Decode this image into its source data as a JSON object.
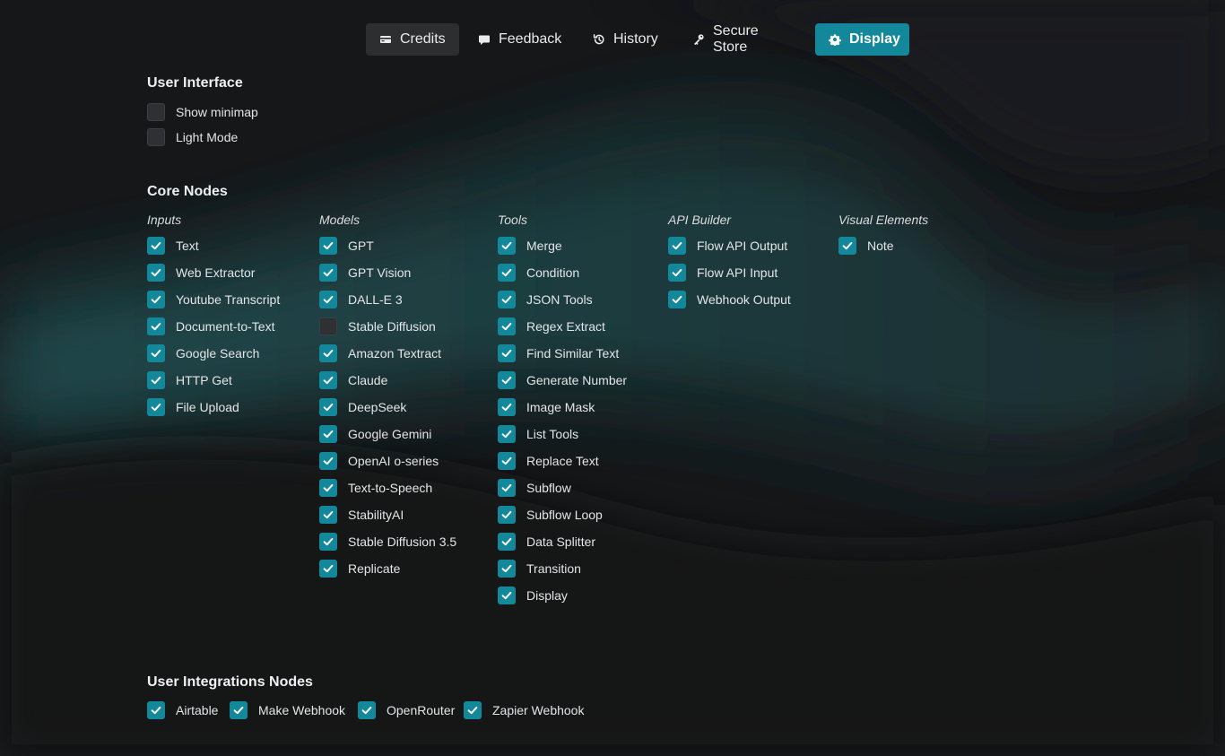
{
  "nav": {
    "tabs": [
      {
        "label": "Credits",
        "icon": "credit-card-icon"
      },
      {
        "label": "Feedback",
        "icon": "chat-bubble-icon"
      },
      {
        "label": "History",
        "icon": "history-icon"
      },
      {
        "label": "Secure Store",
        "icon": "key-icon"
      },
      {
        "label": "Display",
        "icon": "gear-icon"
      }
    ],
    "selected": "Display"
  },
  "colors": {
    "accent": "#12889a",
    "background": "#151719",
    "glow": "#1f4a4c"
  },
  "user_interface": {
    "title": "User Interface",
    "options": [
      {
        "label": "Show minimap",
        "checked": false
      },
      {
        "label": "Light Mode",
        "checked": false
      }
    ]
  },
  "core_nodes": {
    "title": "Core Nodes",
    "columns": [
      {
        "title": "Inputs",
        "items": [
          {
            "label": "Text",
            "checked": true
          },
          {
            "label": "Web Extractor",
            "checked": true
          },
          {
            "label": "Youtube Transcript",
            "checked": true
          },
          {
            "label": "Document-to-Text",
            "checked": true
          },
          {
            "label": "Google Search",
            "checked": true
          },
          {
            "label": "HTTP Get",
            "checked": true
          },
          {
            "label": "File Upload",
            "checked": true
          }
        ]
      },
      {
        "title": "Models",
        "items": [
          {
            "label": "GPT",
            "checked": true
          },
          {
            "label": "GPT Vision",
            "checked": true
          },
          {
            "label": "DALL-E 3",
            "checked": true
          },
          {
            "label": "Stable Diffusion",
            "checked": false
          },
          {
            "label": "Amazon Textract",
            "checked": true
          },
          {
            "label": "Claude",
            "checked": true
          },
          {
            "label": "DeepSeek",
            "checked": true
          },
          {
            "label": "Google Gemini",
            "checked": true
          },
          {
            "label": "OpenAI o-series",
            "checked": true
          },
          {
            "label": "Text-to-Speech",
            "checked": true
          },
          {
            "label": "StabilityAI",
            "checked": true
          },
          {
            "label": "Stable Diffusion 3.5",
            "checked": true
          },
          {
            "label": "Replicate",
            "checked": true
          }
        ]
      },
      {
        "title": "Tools",
        "items": [
          {
            "label": "Merge",
            "checked": true
          },
          {
            "label": "Condition",
            "checked": true
          },
          {
            "label": "JSON Tools",
            "checked": true
          },
          {
            "label": "Regex Extract",
            "checked": true
          },
          {
            "label": "Find Similar Text",
            "checked": true
          },
          {
            "label": "Generate Number",
            "checked": true
          },
          {
            "label": "Image Mask",
            "checked": true
          },
          {
            "label": "List Tools",
            "checked": true
          },
          {
            "label": "Replace Text",
            "checked": true
          },
          {
            "label": "Subflow",
            "checked": true
          },
          {
            "label": "Subflow Loop",
            "checked": true
          },
          {
            "label": "Data Splitter",
            "checked": true
          },
          {
            "label": "Transition",
            "checked": true
          },
          {
            "label": "Display",
            "checked": true
          }
        ]
      },
      {
        "title": "API Builder",
        "items": [
          {
            "label": "Flow API Output",
            "checked": true
          },
          {
            "label": "Flow API Input",
            "checked": true
          },
          {
            "label": "Webhook Output",
            "checked": true
          }
        ]
      },
      {
        "title": "Visual Elements",
        "items": [
          {
            "label": "Note",
            "checked": true
          }
        ]
      }
    ]
  },
  "user_integrations": {
    "title": "User Integrations Nodes",
    "items": [
      {
        "label": "Airtable",
        "checked": true
      },
      {
        "label": "Make Webhook",
        "checked": true
      },
      {
        "label": "OpenRouter",
        "checked": true
      },
      {
        "label": "Zapier Webhook",
        "checked": true
      }
    ]
  }
}
